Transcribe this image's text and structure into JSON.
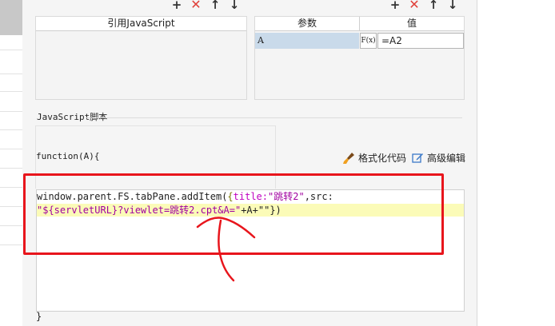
{
  "left_toolbar": {
    "add": "+",
    "delete": "✕",
    "up": "↑",
    "down": "↓"
  },
  "right_toolbar": {
    "add": "+",
    "delete": "✕",
    "up": "↑",
    "down": "↓"
  },
  "ref_js_header": "引用JavaScript",
  "params": {
    "col_param": "参数",
    "col_value": "值",
    "row": {
      "name": "A",
      "fx": "F(x)",
      "value": "=A2"
    }
  },
  "js_section_label": "JavaScript脚本",
  "function_signature": "function(A){",
  "format_button": "格式化代码",
  "advanced_button": "高级编辑",
  "code": {
    "line1_prefix": "window.parent.FS.tabPane.addItem(",
    "line1_brace": "{",
    "line1_title_key": "title:",
    "line1_title_val": "\"跳转2\"",
    "line1_src": ",src:",
    "line2_string": "\"${servletURL}?viewlet=跳转2.cpt&A=\"",
    "line2_rest": "+A+\"\"})"
  },
  "closing_brace": "}",
  "colors": {
    "annotation_red": "#e8151c",
    "selected_row": "#c9daea",
    "highlight_line": "#fbfbb8"
  }
}
